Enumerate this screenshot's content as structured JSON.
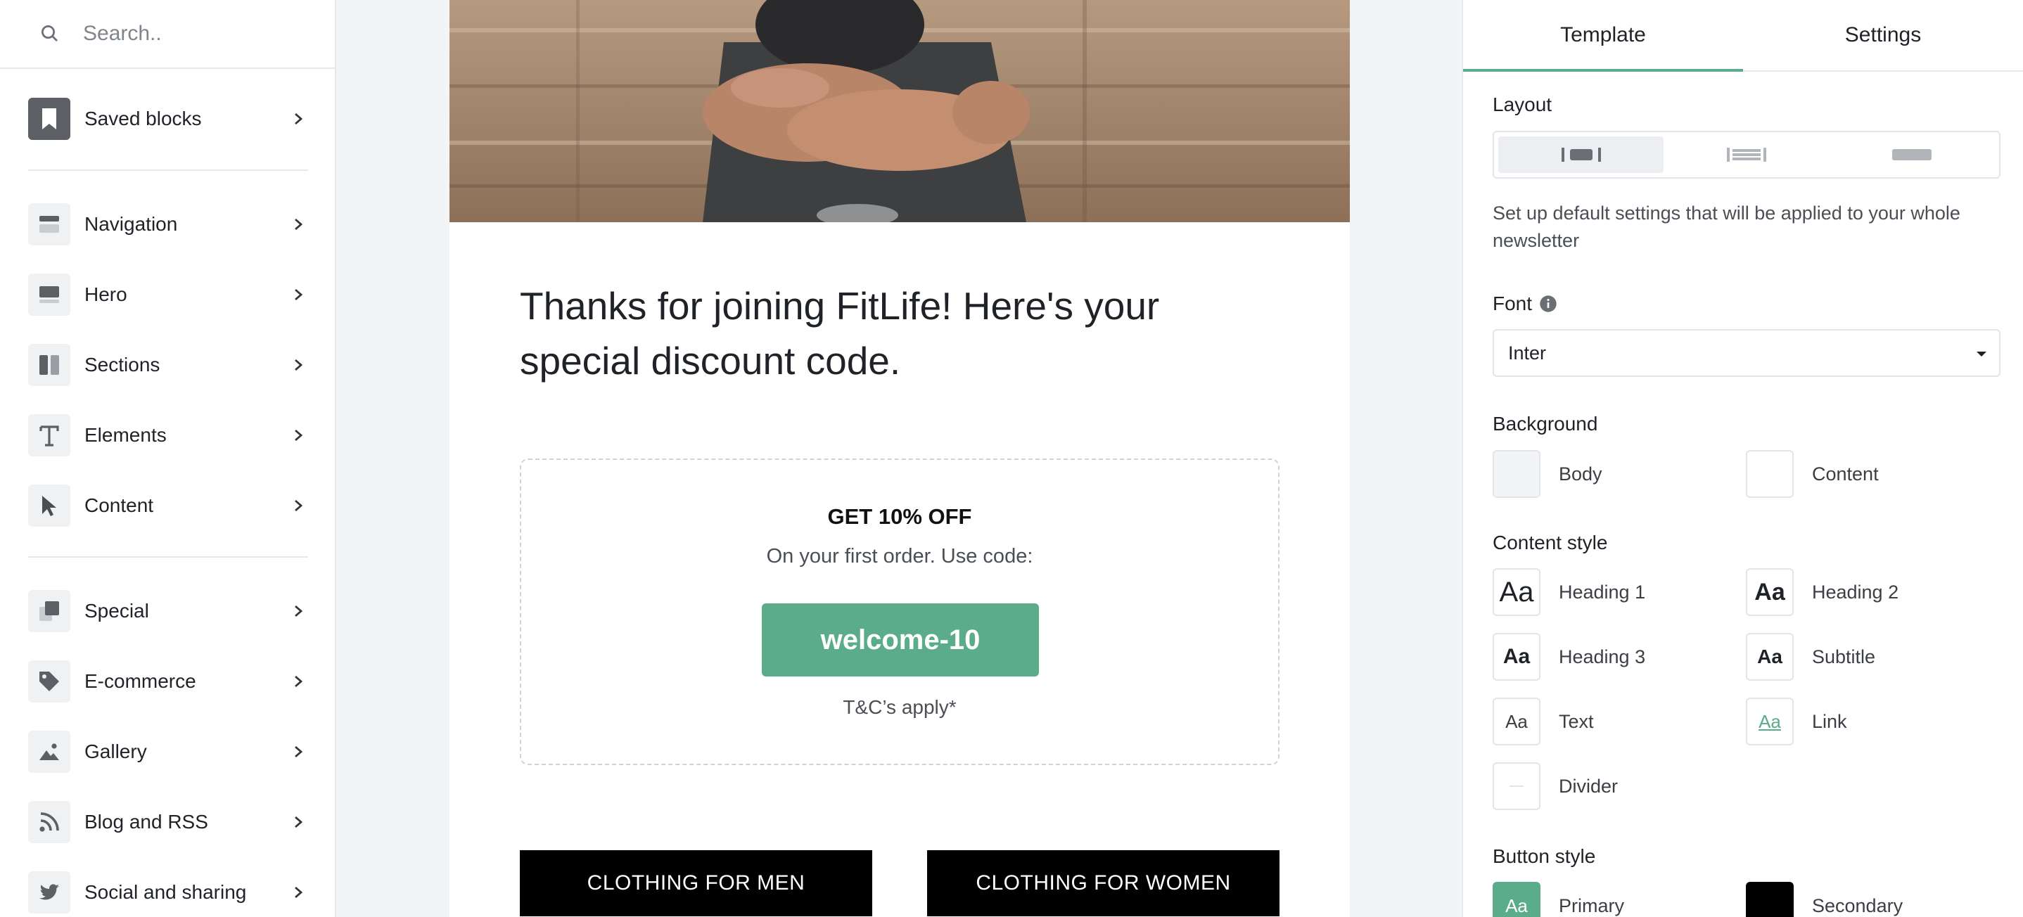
{
  "sidebar": {
    "search": {
      "placeholder": "Search.."
    },
    "items": [
      {
        "label": "Saved blocks",
        "icon": "bookmark-icon"
      },
      {
        "label": "Navigation",
        "icon": "navigation-icon"
      },
      {
        "label": "Hero",
        "icon": "hero-icon"
      },
      {
        "label": "Sections",
        "icon": "sections-icon"
      },
      {
        "label": "Elements",
        "icon": "text-icon"
      },
      {
        "label": "Content",
        "icon": "cursor-icon"
      },
      {
        "label": "Special",
        "icon": "special-icon"
      },
      {
        "label": "E-commerce",
        "icon": "tag-icon"
      },
      {
        "label": "Gallery",
        "icon": "image-icon"
      },
      {
        "label": "Blog and RSS",
        "icon": "rss-icon"
      },
      {
        "label": "Social and sharing",
        "icon": "twitter-icon"
      }
    ]
  },
  "email": {
    "headline": "Thanks for joining FitLife! Here's your special discount code.",
    "coupon": {
      "title": "GET 10% OFF",
      "subtitle": "On your first order. Use code:",
      "code": "welcome-10",
      "terms": "T&C’s apply*"
    },
    "buttons": {
      "men": "CLOTHING FOR MEN",
      "women": "CLOTHING FOR WOMEN"
    }
  },
  "panel": {
    "tabs": [
      "Template",
      "Settings"
    ],
    "active_tab": "Template",
    "layout_label": "Layout",
    "description": "Set up default settings that will be applied to your whole newsletter",
    "font_label": "Font",
    "font_value": "Inter",
    "background_label": "Background",
    "background": {
      "body": "Body",
      "content": "Content"
    },
    "content_style_label": "Content style",
    "content_style": {
      "heading1": "Heading 1",
      "heading2": "Heading 2",
      "heading3": "Heading 3",
      "subtitle": "Subtitle",
      "text": "Text",
      "link": "Link",
      "divider": "Divider",
      "aa": "Aa"
    },
    "button_style_label": "Button style",
    "button_style": {
      "primary": "Primary",
      "secondary": "Secondary"
    }
  },
  "colors": {
    "accent": "#5aac8b",
    "black": "#000000",
    "panel_border": "#e6e8eb",
    "canvas_bg": "#f3f4f6"
  }
}
